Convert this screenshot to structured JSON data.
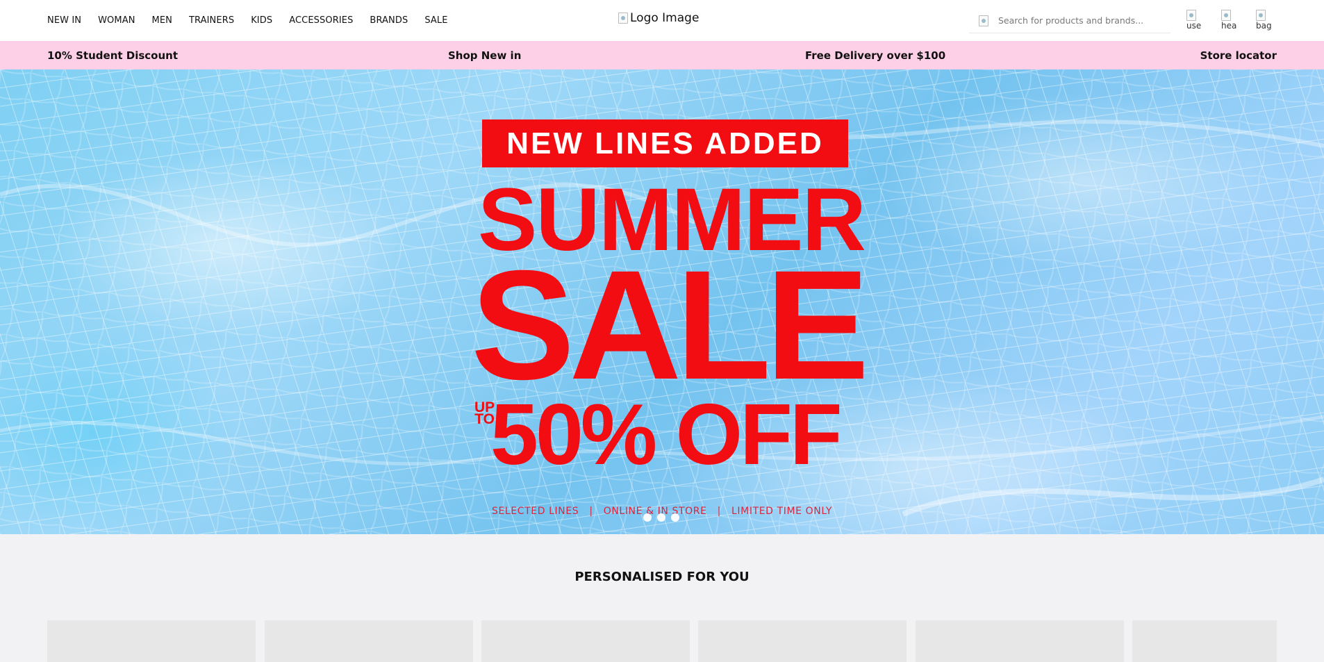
{
  "header": {
    "nav": [
      "NEW IN",
      "WOMAN",
      "MEN",
      "TRAINERS",
      "KIDS",
      "ACCESSORIES",
      "BRANDS",
      "SALE"
    ],
    "logo_alt": "Logo Image",
    "search_placeholder": "Search for products and brands...",
    "icons": [
      {
        "name": "user-icon",
        "alt": "use"
      },
      {
        "name": "heart-icon",
        "alt": "hea"
      },
      {
        "name": "bag-icon",
        "alt": "bag"
      }
    ]
  },
  "promo": {
    "items": [
      "10% Student Discount",
      "Shop New in",
      "Free Delivery over $100",
      "Store locator"
    ]
  },
  "hero": {
    "badge": "NEW LINES ADDED",
    "line1": "SUMMER",
    "line2": "SALE",
    "up": "UP",
    "to": "TO",
    "offer": "50% OFF",
    "tagline": [
      "SELECTED LINES",
      "|",
      "ONLINE & IN STORE",
      "|",
      "LIMITED TIME ONLY"
    ],
    "slides": 3,
    "accent_color": "#f20d12"
  },
  "personalised": {
    "title": "PERSONALISED FOR YOU",
    "card_count": 6
  }
}
